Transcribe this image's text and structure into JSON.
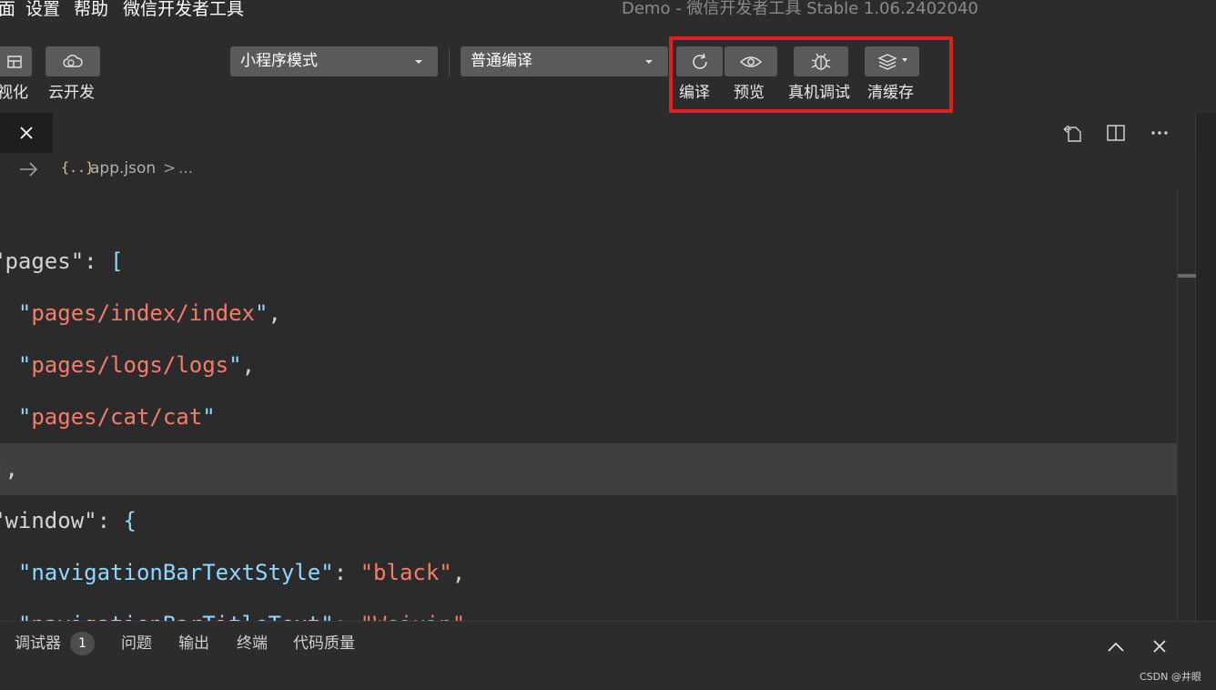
{
  "menubar": {
    "items": [
      "面",
      "设置",
      "帮助",
      "微信开发者工具"
    ],
    "title": "Demo  -  微信开发者工具 Stable 1.06.2402040"
  },
  "toolbar": {
    "left_labels": [
      "视化",
      "云开发"
    ],
    "mode_select": "小程序模式",
    "compile_select": "普通编译",
    "actions": [
      "编译",
      "预览",
      "真机调试",
      "清缓存"
    ],
    "highlight_color": "#e01f1f"
  },
  "tabbar": {
    "active_tab_icon": "close-icon",
    "right_icons": [
      "open-changes-icon",
      "split-editor-icon",
      "more-icon"
    ]
  },
  "breadcrumb": {
    "file_icon": "{..}",
    "file": "app.json",
    "separator": ">",
    "more": "..."
  },
  "editor": {
    "lines": [
      [
        {
          "t": "\"pages\"",
          "c": "p"
        },
        {
          "t": ": ",
          "c": "p"
        },
        {
          "t": "[",
          "c": "k"
        }
      ],
      [
        {
          "t": "  ",
          "c": "p"
        },
        {
          "t": "\"",
          "c": "k"
        },
        {
          "t": "pages/index/index",
          "c": "s"
        },
        {
          "t": "\"",
          "c": "k"
        },
        {
          "t": ",",
          "c": "p"
        }
      ],
      [
        {
          "t": "  ",
          "c": "p"
        },
        {
          "t": "\"",
          "c": "k"
        },
        {
          "t": "pages/logs/logs",
          "c": "s"
        },
        {
          "t": "\"",
          "c": "k"
        },
        {
          "t": ",",
          "c": "p"
        }
      ],
      [
        {
          "t": "  ",
          "c": "p"
        },
        {
          "t": "\"",
          "c": "k"
        },
        {
          "t": "pages/cat/cat",
          "c": "s"
        },
        {
          "t": "\"",
          "c": "k"
        }
      ],
      [
        {
          "t": "]",
          "c": "k"
        },
        {
          "t": ",",
          "c": "p"
        }
      ],
      [
        {
          "t": "\"window\"",
          "c": "p"
        },
        {
          "t": ": ",
          "c": "p"
        },
        {
          "t": "{",
          "c": "k"
        }
      ],
      [
        {
          "t": "  ",
          "c": "p"
        },
        {
          "t": "\"navigationBarTextStyle\"",
          "c": "k"
        },
        {
          "t": ": ",
          "c": "p"
        },
        {
          "t": "\"black\"",
          "c": "s"
        },
        {
          "t": ",",
          "c": "p"
        }
      ],
      [
        {
          "t": "  ",
          "c": "p"
        },
        {
          "t": "\"navigationBarTitleText\"",
          "c": "k"
        },
        {
          "t": ": ",
          "c": "p"
        },
        {
          "t": "\"Weixin\"",
          "c": "s"
        },
        {
          "t": ",",
          "c": "p"
        }
      ]
    ]
  },
  "panel": {
    "tabs": [
      "调试器",
      "问题",
      "输出",
      "终端",
      "代码质量"
    ],
    "badge": "1",
    "watermark": "CSDN @井眼"
  }
}
